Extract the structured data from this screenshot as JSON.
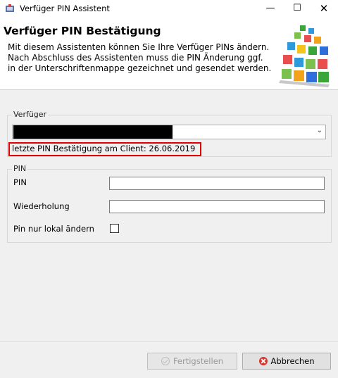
{
  "window": {
    "title": "Verfüger PIN Assistent",
    "minimize_icon": "minimize-icon",
    "maximize_icon": "maximize-icon",
    "close_icon": "close-icon"
  },
  "header": {
    "title": "Verfüger PIN Bestätigung",
    "description": "Mit diesem Assistenten können Sie Ihre Verfüger PINs ändern. Nach Abschluss des Assistenten muss die PIN Änderung ggf. in der Unterschriftenmappe gezeichnet und gesendet werden.",
    "logo_icon": "cube-blocks-logo"
  },
  "verfueger": {
    "legend": "Verfüger",
    "selected_value": "",
    "last_confirmation": "letzte PIN Bestätigung am Client: 26.06.2019",
    "highlight_color": "#e00000"
  },
  "pin_group": {
    "legend": "PIN",
    "pin_label": "PIN",
    "pin_value": "",
    "repeat_label": "Wiederholung",
    "repeat_value": "",
    "local_label": "Pin nur lokal ändern",
    "local_checked": false
  },
  "buttons": {
    "finish_label": "Fertigstellen",
    "finish_enabled": false,
    "cancel_label": "Abbrechen",
    "cancel_icon": "cancel-icon",
    "finish_icon": "check-icon"
  }
}
